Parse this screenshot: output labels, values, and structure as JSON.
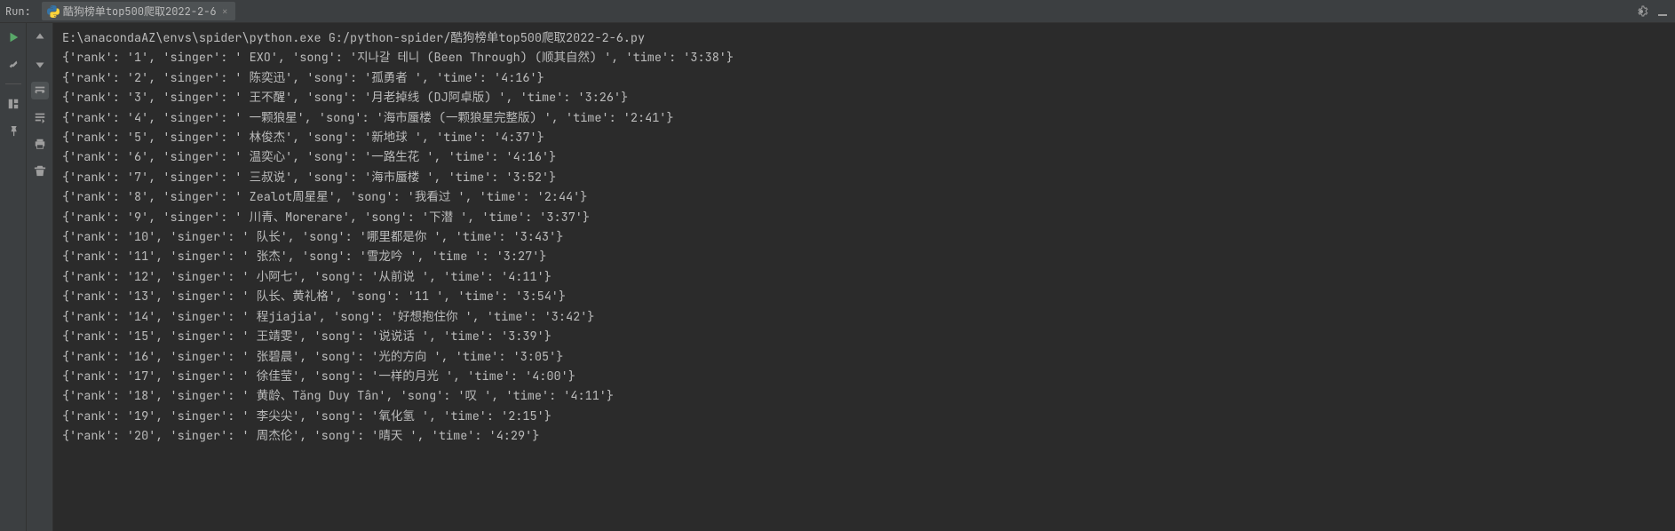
{
  "header": {
    "run_label": "Run:",
    "tab_title": "酷狗榜单top500爬取2022-2-6"
  },
  "command_line": "E:\\anacondaAZ\\envs\\spider\\python.exe G:/python-spider/酷狗榜单top500爬取2022-2-6.py",
  "output_lines": [
    "{'rank': '1', 'singer': ' EXO', 'song': '지나갈 테니 (Been Through) (顺其自然) ', 'time': '3:38'}",
    "{'rank': '2', 'singer': ' 陈奕迅', 'song': '孤勇者 ', 'time': '4:16'}",
    "{'rank': '3', 'singer': ' 王不醒', 'song': '月老掉线 (DJ阿卓版) ', 'time': '3:26'}",
    "{'rank': '4', 'singer': ' 一颗狼星', 'song': '海市蜃楼 (一颗狼星完整版) ', 'time': '2:41'}",
    "{'rank': '5', 'singer': ' 林俊杰', 'song': '新地球 ', 'time': '4:37'}",
    "{'rank': '6', 'singer': ' 温奕心', 'song': '一路生花 ', 'time': '4:16'}",
    "{'rank': '7', 'singer': ' 三叔说', 'song': '海市蜃楼 ', 'time': '3:52'}",
    "{'rank': '8', 'singer': ' Zealot周星星', 'song': '我看过 ', 'time': '2:44'}",
    "{'rank': '9', 'singer': ' 川青、Morerare', 'song': '下潜 ', 'time': '3:37'}",
    "{'rank': '10', 'singer': ' 队长', 'song': '哪里都是你 ', 'time': '3:43'}",
    "{'rank': '11', 'singer': ' 张杰', 'song': '雪龙吟 ', 'time ': '3:27'}",
    "{'rank': '12', 'singer': ' 小阿七', 'song': '从前说 ', 'time': '4:11'}",
    "{'rank': '13', 'singer': ' 队长、黄礼格', 'song': '11 ', 'time': '3:54'}",
    "{'rank': '14', 'singer': ' 程jiajia', 'song': '好想抱住你 ', 'time': '3:42'}",
    "{'rank': '15', 'singer': ' 王靖雯', 'song': '说说话 ', 'time': '3:39'}",
    "{'rank': '16', 'singer': ' 张碧晨', 'song': '光的方向 ', 'time': '3:05'}",
    "{'rank': '17', 'singer': ' 徐佳莹', 'song': '一样的月光 ', 'time': '4:00'}",
    "{'rank': '18', 'singer': ' 黄龄、Tăng Duy Tân', 'song': '叹 ', 'time': '4:11'}",
    "{'rank': '19', 'singer': ' 李尖尖', 'song': '氧化氢 ', 'time': '2:15'}",
    "{'rank': '20', 'singer': ' 周杰伦', 'song': '晴天 ', 'time': '4:29'}"
  ]
}
